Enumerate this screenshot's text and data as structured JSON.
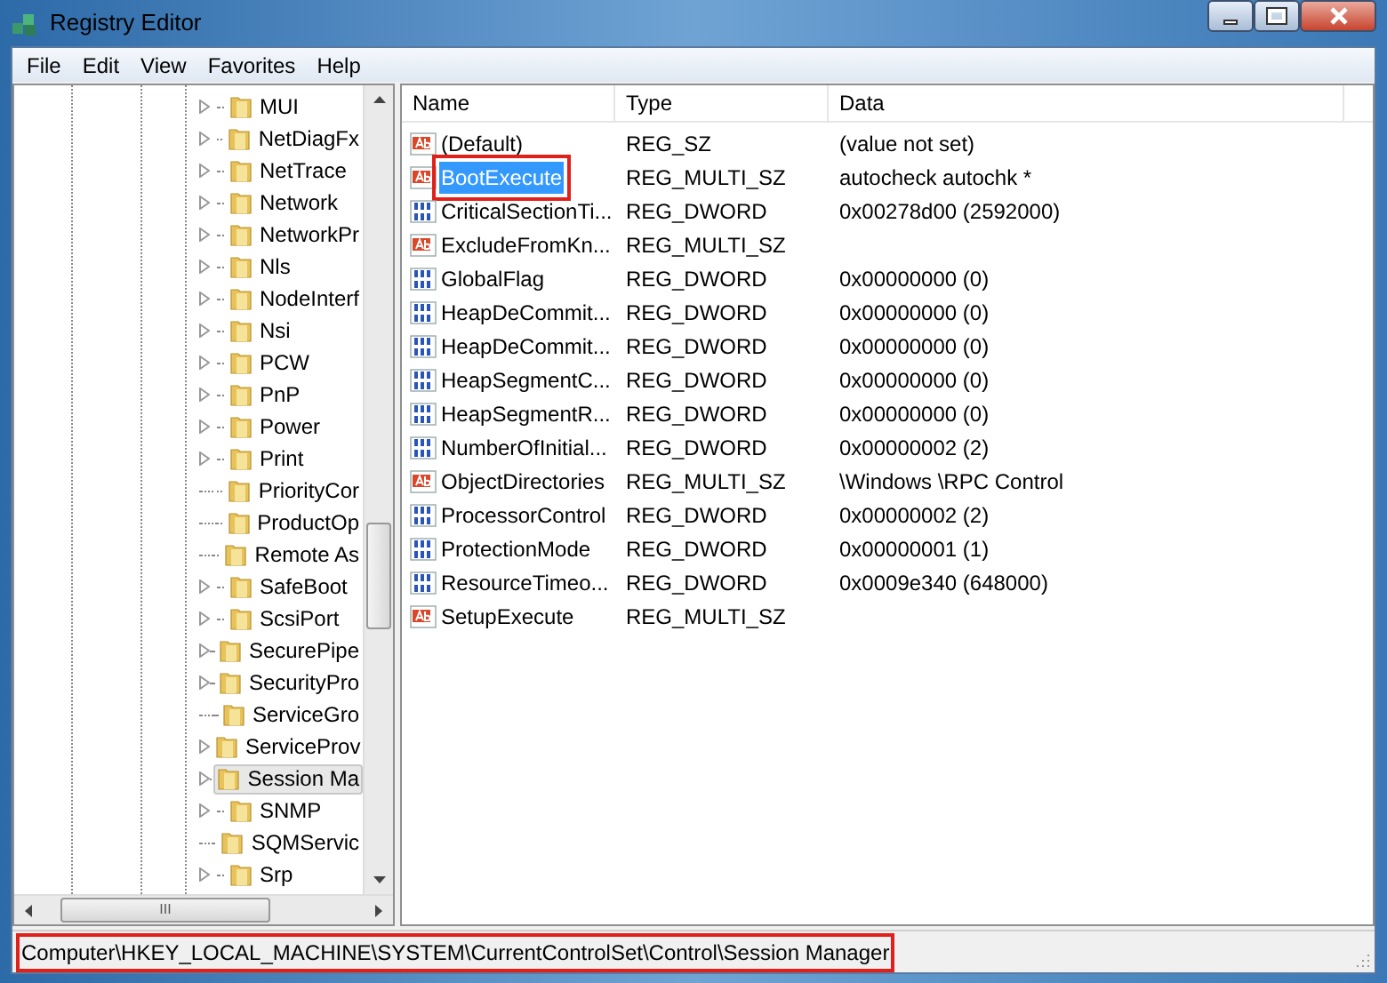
{
  "window": {
    "title": "Registry Editor"
  },
  "menu": [
    "File",
    "Edit",
    "View",
    "Favorites",
    "Help"
  ],
  "tree": [
    {
      "label": "MUI",
      "has_children": true,
      "selected": false
    },
    {
      "label": "NetDiagFx",
      "has_children": true,
      "selected": false
    },
    {
      "label": "NetTrace",
      "has_children": true,
      "selected": false
    },
    {
      "label": "Network",
      "has_children": true,
      "selected": false
    },
    {
      "label": "NetworkPr",
      "has_children": true,
      "selected": false
    },
    {
      "label": "Nls",
      "has_children": true,
      "selected": false
    },
    {
      "label": "NodeInterf",
      "has_children": true,
      "selected": false
    },
    {
      "label": "Nsi",
      "has_children": true,
      "selected": false
    },
    {
      "label": "PCW",
      "has_children": true,
      "selected": false
    },
    {
      "label": "PnP",
      "has_children": true,
      "selected": false
    },
    {
      "label": "Power",
      "has_children": true,
      "selected": false
    },
    {
      "label": "Print",
      "has_children": true,
      "selected": false
    },
    {
      "label": "PriorityCor",
      "has_children": false,
      "selected": false
    },
    {
      "label": "ProductOp",
      "has_children": false,
      "selected": false
    },
    {
      "label": "Remote As",
      "has_children": false,
      "selected": false
    },
    {
      "label": "SafeBoot",
      "has_children": true,
      "selected": false
    },
    {
      "label": "ScsiPort",
      "has_children": true,
      "selected": false
    },
    {
      "label": "SecurePipe",
      "has_children": true,
      "selected": false
    },
    {
      "label": "SecurityPro",
      "has_children": true,
      "selected": false
    },
    {
      "label": "ServiceGro",
      "has_children": false,
      "selected": false
    },
    {
      "label": "ServiceProv",
      "has_children": true,
      "selected": false
    },
    {
      "label": "Session Ma",
      "has_children": true,
      "selected": true
    },
    {
      "label": "SNMP",
      "has_children": true,
      "selected": false
    },
    {
      "label": "SQMServic",
      "has_children": false,
      "selected": false
    },
    {
      "label": "Srp",
      "has_children": true,
      "selected": false
    }
  ],
  "table": {
    "columns": [
      "Name",
      "Type",
      "Data"
    ],
    "rows": [
      {
        "kind": "string",
        "name": "(Default)",
        "type": "REG_SZ",
        "data": "(value not set)",
        "selected": false,
        "highlighted": false
      },
      {
        "kind": "string",
        "name": "BootExecute",
        "type": "REG_MULTI_SZ",
        "data": "autocheck autochk *",
        "selected": true,
        "highlighted": true
      },
      {
        "kind": "binary",
        "name": "CriticalSectionTi...",
        "type": "REG_DWORD",
        "data": "0x00278d00 (2592000)",
        "selected": false,
        "highlighted": false
      },
      {
        "kind": "string",
        "name": "ExcludeFromKn...",
        "type": "REG_MULTI_SZ",
        "selected": false,
        "highlighted": false
      },
      {
        "kind": "binary",
        "name": "GlobalFlag",
        "type": "REG_DWORD",
        "data": "0x00000000 (0)",
        "selected": false,
        "highlighted": false
      },
      {
        "kind": "binary",
        "name": "HeapDeCommit...",
        "type": "REG_DWORD",
        "data": "0x00000000 (0)",
        "selected": false,
        "highlighted": false
      },
      {
        "kind": "binary",
        "name": "HeapDeCommit...",
        "type": "REG_DWORD",
        "data": "0x00000000 (0)",
        "selected": false,
        "highlighted": false
      },
      {
        "kind": "binary",
        "name": "HeapSegmentC...",
        "type": "REG_DWORD",
        "data": "0x00000000 (0)",
        "selected": false,
        "highlighted": false
      },
      {
        "kind": "binary",
        "name": "HeapSegmentR...",
        "type": "REG_DWORD",
        "data": "0x00000000 (0)",
        "selected": false,
        "highlighted": false
      },
      {
        "kind": "binary",
        "name": "NumberOfInitial...",
        "type": "REG_DWORD",
        "data": "0x00000002 (2)",
        "selected": false,
        "highlighted": false
      },
      {
        "kind": "string",
        "name": "ObjectDirectories",
        "type": "REG_MULTI_SZ",
        "data": "\\Windows \\RPC Control",
        "selected": false,
        "highlighted": false
      },
      {
        "kind": "binary",
        "name": "ProcessorControl",
        "type": "REG_DWORD",
        "data": "0x00000002 (2)",
        "selected": false,
        "highlighted": false
      },
      {
        "kind": "binary",
        "name": "ProtectionMode",
        "type": "REG_DWORD",
        "data": "0x00000001 (1)",
        "selected": false,
        "highlighted": false
      },
      {
        "kind": "binary",
        "name": "ResourceTimeo...",
        "type": "REG_DWORD",
        "data": "0x0009e340 (648000)",
        "selected": false,
        "highlighted": false
      },
      {
        "kind": "string",
        "name": "SetupExecute",
        "type": "REG_MULTI_SZ",
        "selected": false,
        "highlighted": false
      }
    ]
  },
  "status_bar": {
    "path": "Computer\\HKEY_LOCAL_MACHINE\\SYSTEM\\CurrentControlSet\\Control\\Session Manager",
    "highlighted": true
  },
  "scroll_mark": "III"
}
